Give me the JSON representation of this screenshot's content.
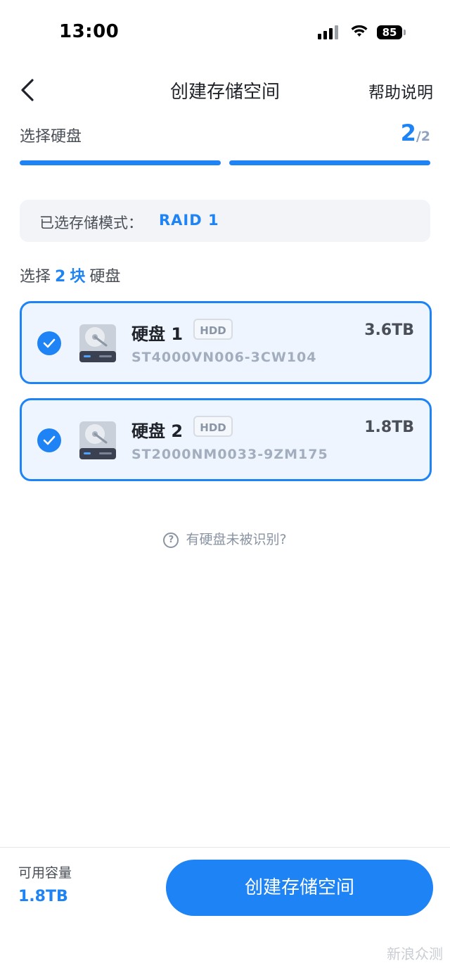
{
  "status_bar": {
    "time": "13:00",
    "battery": "85"
  },
  "header": {
    "title": "创建存储空间",
    "help": "帮助说明"
  },
  "step": {
    "label": "选择硬盘",
    "current": "2",
    "total": "/2"
  },
  "mode": {
    "label": "已选存储模式：",
    "value": "RAID 1"
  },
  "select_hint": {
    "prefix": "选择",
    "count": "2",
    "unit": "块",
    "suffix": "硬盘"
  },
  "disks": [
    {
      "name": "硬盘 1",
      "tag": "HDD",
      "size": "3.6TB",
      "model": "ST4000VN006-3CW104",
      "selected": true
    },
    {
      "name": "硬盘 2",
      "tag": "HDD",
      "size": "1.8TB",
      "model": "ST2000NM0033-9ZM175",
      "selected": true
    }
  ],
  "unrecognized": "有硬盘未被识别?",
  "footer": {
    "capacity_label": "可用容量",
    "capacity_value": "1.8TB",
    "create_button": "创建存储空间"
  },
  "watermark": "新浪众测",
  "colors": {
    "accent": "#1e83f5",
    "card_bg": "#eef5ff",
    "mode_bg": "#f2f4f7"
  },
  "icons": [
    "back-icon",
    "checkmark-icon",
    "hard-disk-icon",
    "help-circle-icon",
    "wifi-icon",
    "signal-icon",
    "battery-icon"
  ]
}
